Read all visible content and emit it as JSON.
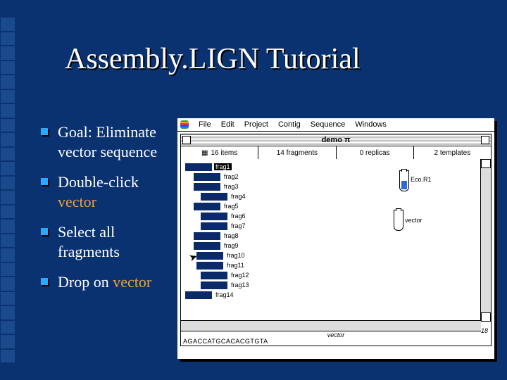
{
  "slide": {
    "title": "Assembly.LIGN Tutorial",
    "bullets": [
      {
        "text": "Goal: Eliminate vector sequence"
      },
      {
        "text_pre": "Double-click ",
        "hl": "vector"
      },
      {
        "text": "Select all fragments"
      },
      {
        "text_pre": "Drop on ",
        "hl": "vector"
      }
    ]
  },
  "mac": {
    "menu": [
      "File",
      "Edit",
      "Project",
      "Contig",
      "Sequence",
      "Windows"
    ],
    "window_title": "demo π",
    "status": {
      "items": "16 items",
      "fragments": "14 fragments",
      "replicas": "0 replicas",
      "templates": "2 templates"
    },
    "fragments": [
      "frag1",
      "frag2",
      "frag3",
      "frag4",
      "frag5",
      "frag6",
      "frag7",
      "frag8",
      "frag9",
      "frag10",
      "frag11",
      "frag12",
      "frag13",
      "frag14"
    ],
    "enzyme_label": "Eco.R1",
    "vector_label": "vector",
    "footer_label": "vector",
    "sequence": "AGACCATGCACACGTGTA",
    "page_no": "18"
  }
}
